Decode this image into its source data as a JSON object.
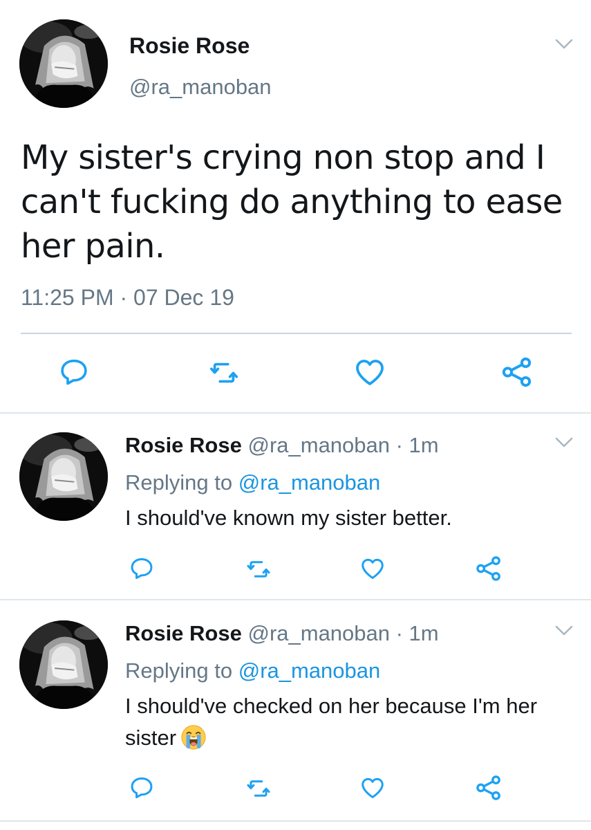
{
  "colors": {
    "text": "#14171a",
    "secondary": "#657786",
    "link": "#1b95e0",
    "icon": "#1da1f2",
    "divider": "#dfe5ea"
  },
  "main_tweet": {
    "avatar": "profile-photo",
    "name": "Rosie Rose",
    "handle": "@ra_manoban",
    "text": "My sister's crying non stop and I can't fucking do anything to ease her pain.",
    "timestamp": "11:25 PM · 07 Dec 19",
    "menu_icon": "chevron-down-icon",
    "actions": [
      "reply-icon",
      "retweet-icon",
      "like-icon",
      "share-icon"
    ]
  },
  "replies": [
    {
      "avatar": "profile-photo",
      "name": "Rosie Rose",
      "meta": "@ra_manoban · 1m",
      "replying_prefix": "Replying to ",
      "replying_to": "@ra_manoban",
      "text": "I should've known my sister better.",
      "emoji": "",
      "menu_icon": "chevron-down-icon",
      "actions": [
        "reply-icon",
        "retweet-icon",
        "like-icon",
        "share-icon"
      ]
    },
    {
      "avatar": "profile-photo",
      "name": "Rosie Rose",
      "meta": "@ra_manoban · 1m",
      "replying_prefix": "Replying to ",
      "replying_to": "@ra_manoban",
      "text": "I should've checked on her because I'm her sister",
      "emoji": "loudly-crying-face-emoji",
      "menu_icon": "chevron-down-icon",
      "actions": [
        "reply-icon",
        "retweet-icon",
        "like-icon",
        "share-icon"
      ]
    }
  ]
}
